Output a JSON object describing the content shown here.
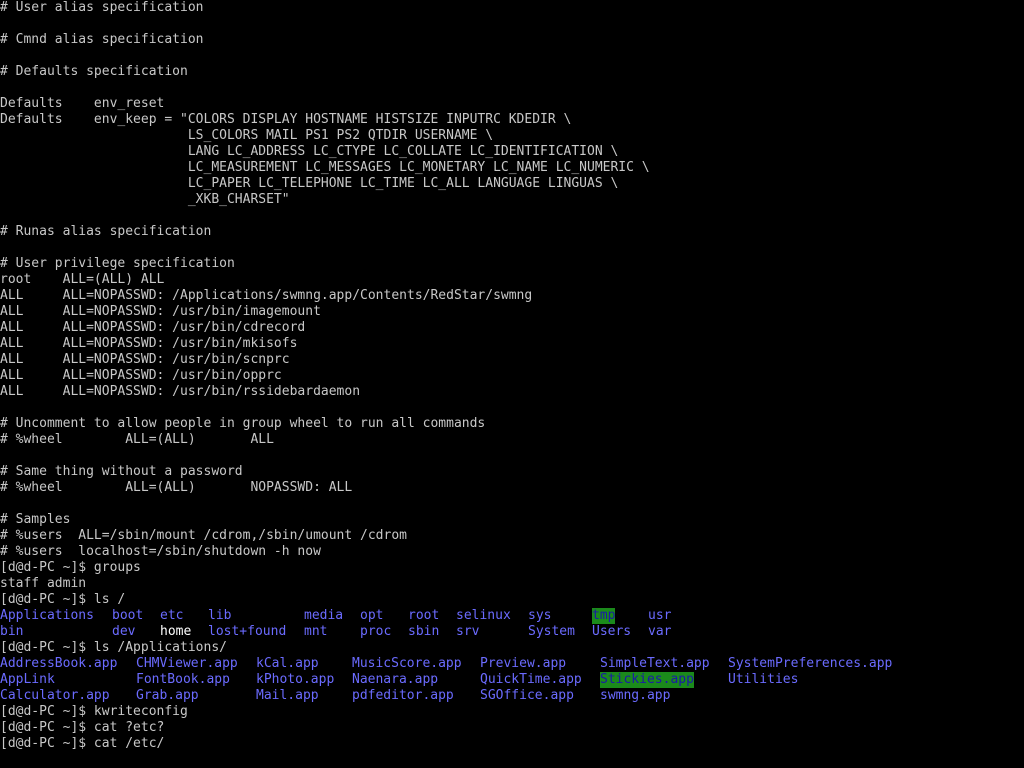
{
  "colors": {
    "background": "#000000",
    "text": "#c8c8c8",
    "directory": "#6b6bff",
    "highlight": "#ffffff",
    "sticky_bg": "#1b8a1b"
  },
  "lines": [
    {
      "row": 1,
      "text": "# User alias specification"
    },
    {
      "row": 3,
      "text": "# Cmnd alias specification"
    },
    {
      "row": 5,
      "text": "# Defaults specification"
    },
    {
      "row": 7,
      "text": "Defaults    env_reset"
    },
    {
      "row": 8,
      "text": "Defaults    env_keep = \"COLORS DISPLAY HOSTNAME HISTSIZE INPUTRC KDEDIR \\"
    },
    {
      "row": 9,
      "text": "                        LS_COLORS MAIL PS1 PS2 QTDIR USERNAME \\"
    },
    {
      "row": 10,
      "text": "                        LANG LC_ADDRESS LC_CTYPE LC_COLLATE LC_IDENTIFICATION \\"
    },
    {
      "row": 11,
      "text": "                        LC_MEASUREMENT LC_MESSAGES LC_MONETARY LC_NAME LC_NUMERIC \\"
    },
    {
      "row": 12,
      "text": "                        LC_PAPER LC_TELEPHONE LC_TIME LC_ALL LANGUAGE LINGUAS \\"
    },
    {
      "row": 13,
      "text": "                        _XKB_CHARSET\""
    },
    {
      "row": 15,
      "text": "# Runas alias specification"
    },
    {
      "row": 17,
      "text": "# User privilege specification"
    },
    {
      "row": 18,
      "text": "root    ALL=(ALL) ALL"
    },
    {
      "row": 19,
      "text": "ALL     ALL=NOPASSWD: /Applications/swmng.app/Contents/RedStar/swmng"
    },
    {
      "row": 20,
      "text": "ALL     ALL=NOPASSWD: /usr/bin/imagemount"
    },
    {
      "row": 21,
      "text": "ALL     ALL=NOPASSWD: /usr/bin/cdrecord"
    },
    {
      "row": 22,
      "text": "ALL     ALL=NOPASSWD: /usr/bin/mkisofs"
    },
    {
      "row": 23,
      "text": "ALL     ALL=NOPASSWD: /usr/bin/scnprc"
    },
    {
      "row": 24,
      "text": "ALL     ALL=NOPASSWD: /usr/bin/opprc"
    },
    {
      "row": 25,
      "text": "ALL     ALL=NOPASSWD: /usr/bin/rssidebardaemon"
    },
    {
      "row": 27,
      "text": "# Uncomment to allow people in group wheel to run all commands"
    },
    {
      "row": 28,
      "text": "# %wheel        ALL=(ALL)       ALL"
    },
    {
      "row": 30,
      "text": "# Same thing without a password"
    },
    {
      "row": 31,
      "text": "# %wheel        ALL=(ALL)       NOPASSWD: ALL"
    },
    {
      "row": 33,
      "text": "# Samples"
    },
    {
      "row": 34,
      "text": "# %users  ALL=/sbin/mount /cdrom,/sbin/umount /cdrom"
    },
    {
      "row": 35,
      "text": "# %users  localhost=/sbin/shutdown -h now"
    },
    {
      "row": 36,
      "text": "[d@d-PC ~]$ groups"
    },
    {
      "row": 37,
      "text": "staff admin"
    },
    {
      "row": 38,
      "text": "[d@d-PC ~]$ ls /"
    },
    {
      "row": 41,
      "text": "[d@d-PC ~]$ ls /Applications/"
    },
    {
      "row": 45,
      "text": "[d@d-PC ~]$ kwriteconfig"
    },
    {
      "row": 46,
      "text": "[d@d-PC ~]$ cat ?etc?"
    },
    {
      "row": 47,
      "text": "[d@d-PC ~]$ cat /etc/"
    }
  ],
  "ls_root": [
    [
      {
        "col": 0,
        "text": "Applications",
        "type": "dir"
      },
      {
        "col": 14,
        "text": "boot",
        "type": "dir"
      },
      {
        "col": 20,
        "text": "etc",
        "type": "dir"
      },
      {
        "col": 26,
        "text": "lib",
        "type": "dir"
      },
      {
        "col": 38,
        "text": "media",
        "type": "dir"
      },
      {
        "col": 45,
        "text": "opt",
        "type": "dir"
      },
      {
        "col": 51,
        "text": "root",
        "type": "dir"
      },
      {
        "col": 57,
        "text": "selinux",
        "type": "dir"
      },
      {
        "col": 66,
        "text": "sys",
        "type": "dir"
      },
      {
        "col": 74,
        "text": "tmp",
        "type": "sticky"
      },
      {
        "col": 81,
        "text": "usr",
        "type": "dir"
      }
    ],
    [
      {
        "col": 0,
        "text": "bin",
        "type": "dir"
      },
      {
        "col": 14,
        "text": "dev",
        "type": "dir"
      },
      {
        "col": 20,
        "text": "home",
        "type": "hl"
      },
      {
        "col": 26,
        "text": "lost+found",
        "type": "dir"
      },
      {
        "col": 38,
        "text": "mnt",
        "type": "dir"
      },
      {
        "col": 45,
        "text": "proc",
        "type": "dir"
      },
      {
        "col": 51,
        "text": "sbin",
        "type": "dir"
      },
      {
        "col": 57,
        "text": "srv",
        "type": "dir"
      },
      {
        "col": 66,
        "text": "System",
        "type": "dir"
      },
      {
        "col": 74,
        "text": "Users",
        "type": "dir"
      },
      {
        "col": 81,
        "text": "var",
        "type": "dir"
      }
    ]
  ],
  "ls_apps": [
    [
      {
        "col": 0,
        "text": "AddressBook.app",
        "type": "dir"
      },
      {
        "col": 17,
        "text": "CHMViewer.app",
        "type": "dir"
      },
      {
        "col": 32,
        "text": "kCal.app",
        "type": "dir"
      },
      {
        "col": 44,
        "text": "MusicScore.app",
        "type": "dir"
      },
      {
        "col": 60,
        "text": "Preview.app",
        "type": "dir"
      },
      {
        "col": 75,
        "text": "SimpleText.app",
        "type": "dir"
      },
      {
        "col": 91,
        "text": "SystemPreferences.app",
        "type": "dir"
      }
    ],
    [
      {
        "col": 0,
        "text": "AppLink",
        "type": "dir"
      },
      {
        "col": 17,
        "text": "FontBook.app",
        "type": "dir"
      },
      {
        "col": 32,
        "text": "kPhoto.app",
        "type": "dir"
      },
      {
        "col": 44,
        "text": "Naenara.app",
        "type": "dir"
      },
      {
        "col": 60,
        "text": "QuickTime.app",
        "type": "dir"
      },
      {
        "col": 75,
        "text": "Stickies.app",
        "type": "sticky"
      },
      {
        "col": 91,
        "text": "Utilities",
        "type": "dir"
      }
    ],
    [
      {
        "col": 0,
        "text": "Calculator.app",
        "type": "dir"
      },
      {
        "col": 17,
        "text": "Grab.app",
        "type": "dir"
      },
      {
        "col": 32,
        "text": "Mail.app",
        "type": "dir"
      },
      {
        "col": 44,
        "text": "pdfeditor.app",
        "type": "dir"
      },
      {
        "col": 60,
        "text": "SGOffice.app",
        "type": "dir"
      },
      {
        "col": 75,
        "text": "swmng.app",
        "type": "dir"
      }
    ]
  ]
}
